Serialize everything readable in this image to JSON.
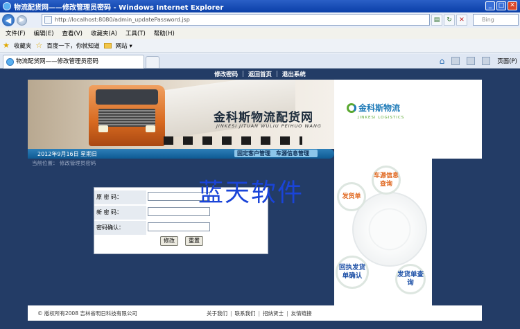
{
  "window": {
    "title": "物流配货网——修改管理员密码 - Windows Internet Explorer"
  },
  "address_bar": {
    "url": "http://localhost:8080/admin_updatePassword.jsp",
    "search_placeholder": "Bing"
  },
  "menu": {
    "items": [
      "文件(F)",
      "编辑(E)",
      "查看(V)",
      "收藏夹(A)",
      "工具(T)",
      "帮助(H)"
    ]
  },
  "favorites_bar": {
    "favorites_label": "收藏夹",
    "links": [
      "百度一下，你就知道",
      "网站 ▾"
    ]
  },
  "tab": {
    "title": "物流配货网——修改管理员密码"
  },
  "command_bar": {
    "page_label": "页面(P)"
  },
  "site": {
    "top_nav": [
      "修改密码",
      "返回首页",
      "退出系统"
    ],
    "banner_title": "金科斯物流配货网",
    "banner_subtitle": "JINKESI JITUAN WULIU PEIHUO WANG",
    "logo_cn": "金科斯物流",
    "logo_en": "JINKESI LOGISTICS",
    "date": "2012年9月16日 星期日",
    "status_links": [
      "固定客户管理",
      "车源信息管理"
    ],
    "breadcrumb": "当前位置： 修改管理员密码",
    "form": {
      "old_password_label": "原 密 码：",
      "new_password_label": "新 密 码：",
      "confirm_label": "密码确认：",
      "submit_label": "修改",
      "reset_label": "重置"
    },
    "watermark": "蓝天软件",
    "side_bubbles": [
      "车源信息查询",
      "发货单",
      "回执发货单确认",
      "发货单查询"
    ],
    "footer_copyright": "© 版权所有2008 吉林省明日科技有限公司",
    "footer_links": [
      "关于我们",
      "联系我们",
      "招纳贤士",
      "友情链接"
    ]
  }
}
